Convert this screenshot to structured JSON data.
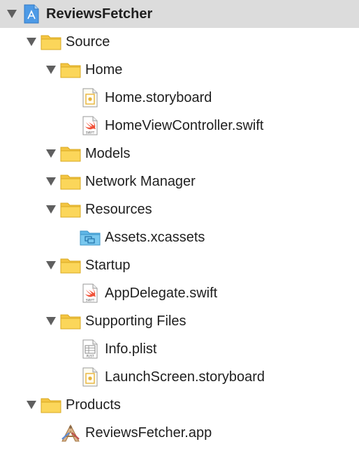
{
  "tree": {
    "project": {
      "label": "ReviewsFetcher"
    },
    "source": {
      "label": "Source"
    },
    "home": {
      "label": "Home"
    },
    "home_storyboard": {
      "label": "Home.storyboard"
    },
    "home_vc": {
      "label": "HomeViewController.swift",
      "badge": "SWIFT"
    },
    "models": {
      "label": "Models"
    },
    "network_manager": {
      "label": "Network Manager"
    },
    "resources": {
      "label": "Resources"
    },
    "assets": {
      "label": "Assets.xcassets"
    },
    "startup": {
      "label": "Startup"
    },
    "app_delegate": {
      "label": "AppDelegate.swift",
      "badge": "SWIFT"
    },
    "supporting_files": {
      "label": "Supporting Files"
    },
    "info_plist": {
      "label": "Info.plist",
      "badge": "PLIST"
    },
    "launch_screen": {
      "label": "LaunchScreen.storyboard"
    },
    "products": {
      "label": "Products"
    },
    "app": {
      "label": "ReviewsFetcher.app"
    }
  },
  "colors": {
    "folder": "#f9cf4e",
    "folder_dark": "#e6b531",
    "asset_folder": "#6cc0ea",
    "project": "#3a8fdf",
    "swift": "#f05138",
    "selection": "#dcdcdc",
    "disclosure": "#5f5f5f"
  }
}
